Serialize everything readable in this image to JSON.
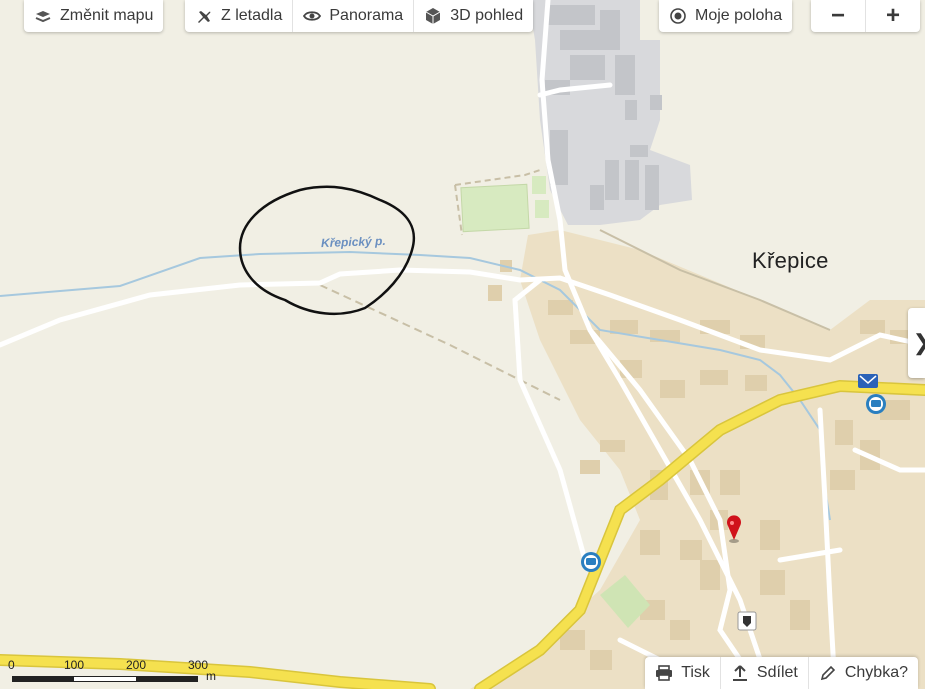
{
  "toolbar": {
    "change_map": "Změnit mapu",
    "aerial": "Z letadla",
    "panorama": "Panorama",
    "view3d": "3D pohled",
    "my_location": "Moje poloha"
  },
  "zoom": {
    "out": "−",
    "in": "+"
  },
  "bottom": {
    "print": "Tisk",
    "share": "Sdílet",
    "error": "Chybka?"
  },
  "side_toggle": "❯",
  "map": {
    "place_name": "Křepice",
    "stream_name": "Křepický p."
  },
  "scale": {
    "labels": [
      "0",
      "100",
      "200",
      "300"
    ],
    "unit": "m"
  },
  "colors": {
    "land": "#f1efe4",
    "built": "#ece0c5",
    "industrial": "#d8d9dc",
    "main_road": "#f5e14f",
    "water": "#a6c8de",
    "green": "#d7eac0"
  }
}
